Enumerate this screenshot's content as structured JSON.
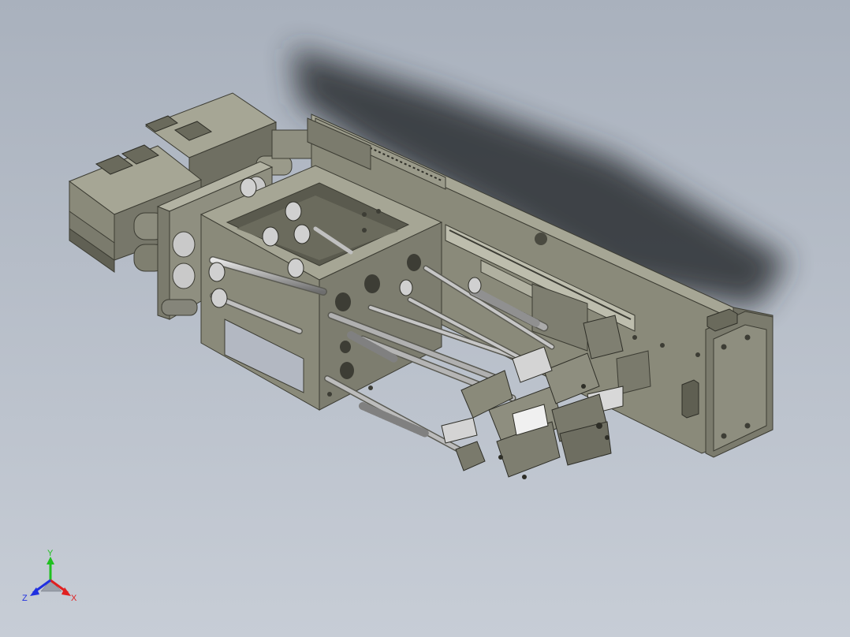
{
  "viewport": {
    "background_top": "#a9b1bd",
    "background_bottom": "#c7cdd6"
  },
  "model": {
    "body_color": "#8a8a7a",
    "body_dark": "#5f5f52",
    "body_light": "#a6a695",
    "metal_color": "#c8c8c8",
    "shadow_color": "#2b2e33"
  },
  "triad": {
    "x_label": "X",
    "y_label": "Y",
    "z_label": "Z",
    "x_color": "#e02020",
    "y_color": "#20c020",
    "z_color": "#2030e0"
  }
}
